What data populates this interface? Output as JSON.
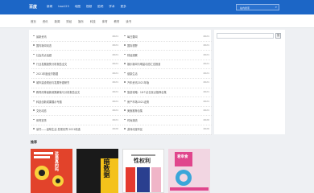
{
  "header": {
    "logo": "百度",
    "nav": [
      "新闻",
      "hao123",
      "地图",
      "视频",
      "贴吧",
      "学术",
      "更多"
    ],
    "search_placeholder": "站内搜索"
  },
  "subnav": {
    "items": [
      "首页",
      "资讯",
      "新闻",
      "财经",
      "娱乐",
      "科技",
      "体育",
      "教育",
      "读书"
    ]
  },
  "list_left": [
    {
      "title": "最新资讯",
      "date": "2021"
    },
    {
      "title": "国内新闻动态",
      "date": "2021"
    },
    {
      "title": "社会热点话题",
      "date": "2021"
    },
    {
      "title": "行业发展趋势分析报告全文",
      "date": "2021"
    },
    {
      "title": "2021年度经济数据",
      "date": "2021"
    },
    {
      "title": "城市建设规划与发展专题研究",
      "date": "2021"
    },
    {
      "title": "教育改革最新政策解读与分析报告全文",
      "date": "2021"
    },
    {
      "title": "科技创新成果展示专题",
      "date": "2021"
    },
    {
      "title": "文化动态",
      "date": "2021"
    },
    {
      "title": "体育赛事",
      "date": "2021"
    },
    {
      "title": "读书——品味生活 发现世界 2021精选",
      "date": "2020"
    }
  ],
  "list_right": [
    {
      "title": "每日要闻",
      "date": "2021"
    },
    {
      "title": "国际视野",
      "date": "2021"
    },
    {
      "title": "财经观察",
      "date": "2021"
    },
    {
      "title": "娱乐新闻与明星动态汇总报道",
      "date": "2021"
    },
    {
      "title": "健康生活",
      "date": "2021"
    },
    {
      "title": "汽车资讯2021年版",
      "date": "2021"
    },
    {
      "title": "旅游攻略：18个必去景点推荐合集",
      "date": "2021"
    },
    {
      "title": "房产市场2021走势",
      "date": "2021"
    },
    {
      "title": "美食推荐合集",
      "date": "2021"
    },
    {
      "title": "时尚潮流",
      "date": "2020"
    },
    {
      "title": "游戏动漫专区",
      "date": "2020"
    }
  ],
  "sidebar": {
    "search_button": "搜"
  },
  "books": {
    "heading": "推荐",
    "items": [
      {
        "title": "这是真的吗",
        "bg": "#e2432b"
      },
      {
        "title": "暗数据",
        "bg": "#f4c21b"
      },
      {
        "title": "性权利",
        "bg": "#ffffff"
      },
      {
        "title": "君幸食",
        "bg": "#f2d6e2"
      }
    ]
  }
}
